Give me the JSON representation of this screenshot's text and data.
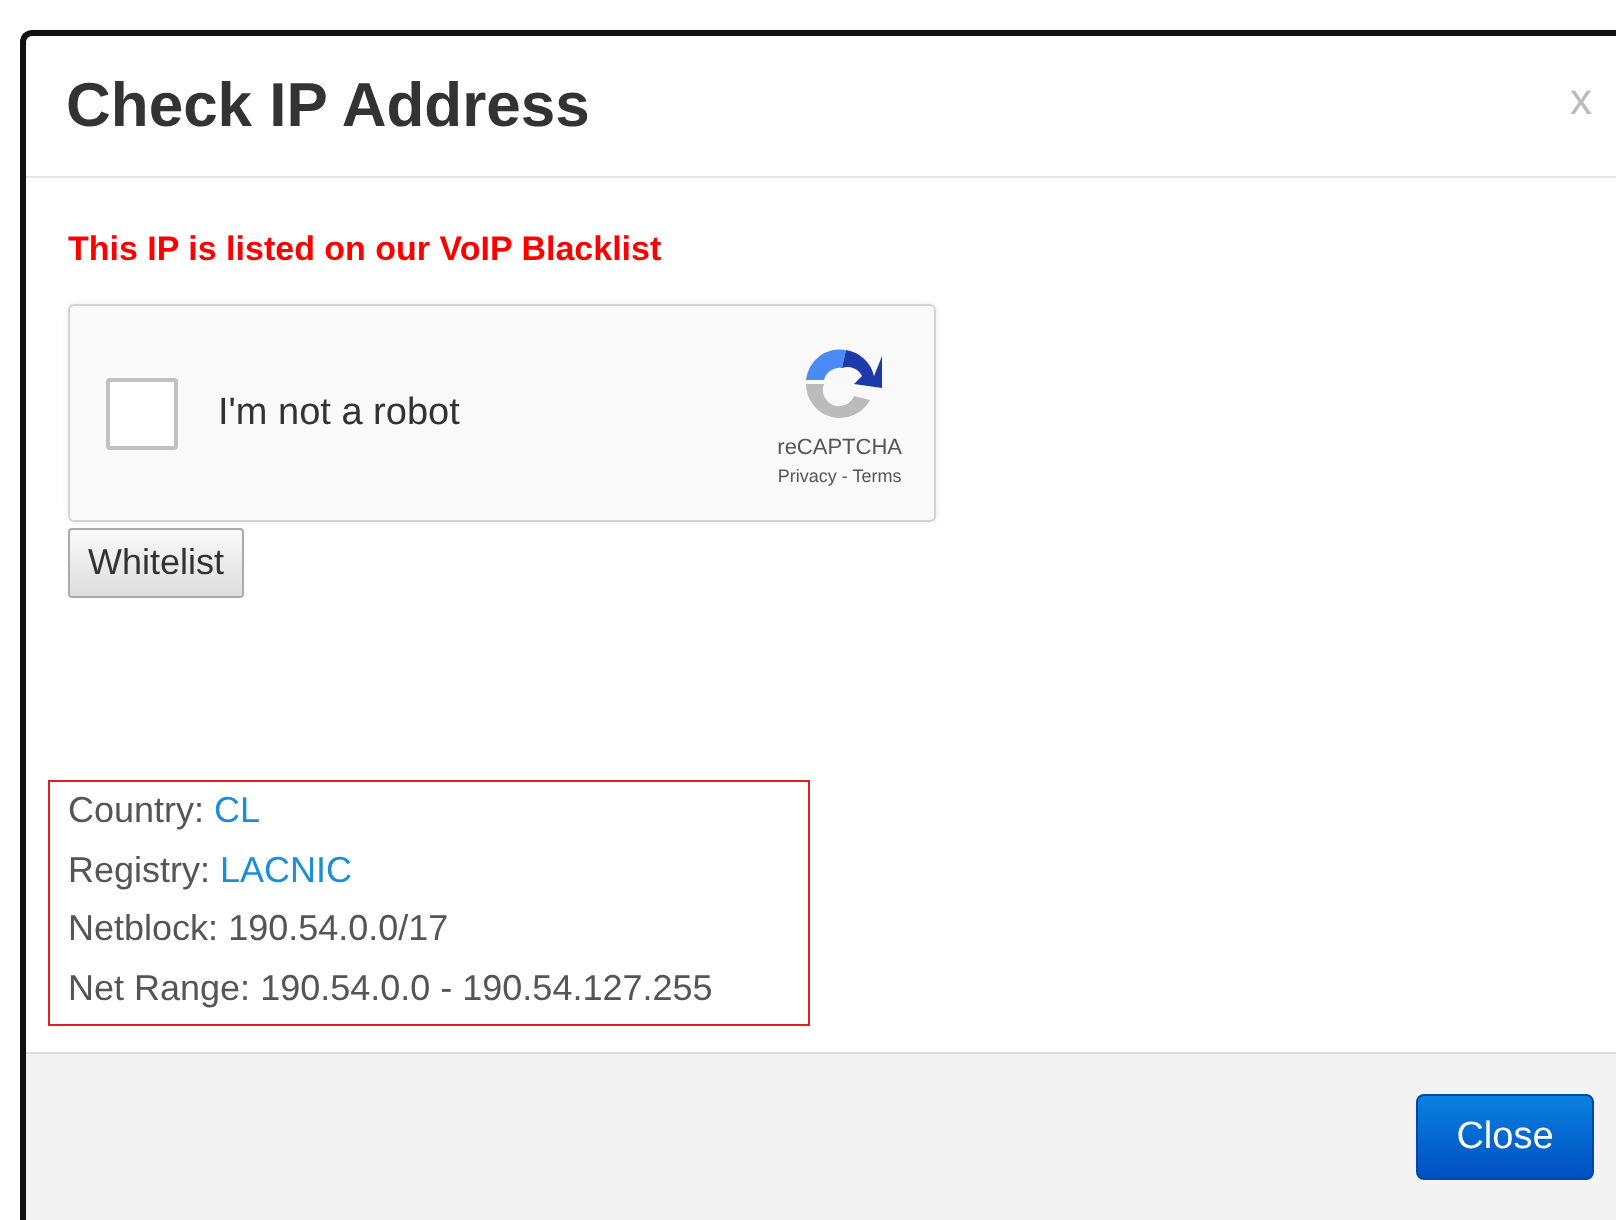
{
  "dialog": {
    "title": "Check IP Address",
    "close_icon": "x"
  },
  "alert": "This IP is listed on our VoIP Blacklist",
  "captcha": {
    "label": "I'm not a robot",
    "checked": false,
    "brand": "reCAPTCHA",
    "links": "Privacy - Terms"
  },
  "whitelist_button": "Whitelist",
  "info": [
    {
      "label": "Country:",
      "value": "CL",
      "kind": "link"
    },
    {
      "label": "Registry:",
      "value": "LACNIC",
      "kind": "link"
    },
    {
      "label": "Netblock:",
      "value": "190.54.0.0/17",
      "kind": "text"
    },
    {
      "label": "Net Range:",
      "value": "190.54.0.0 - 190.54.127.255",
      "kind": "text"
    }
  ],
  "footer": {
    "close_button": "Close"
  }
}
